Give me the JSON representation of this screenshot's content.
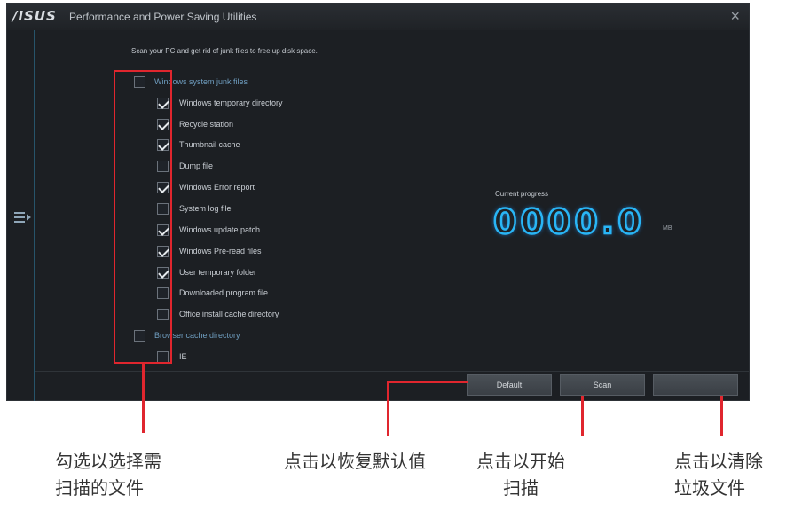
{
  "window": {
    "logo": "/ISUS",
    "title": "Performance and Power Saving Utilities",
    "close": "×"
  },
  "instruction": "Scan your PC and get rid of junk files to free up disk space.",
  "categories": [
    {
      "label": "Windows system junk files",
      "checked": false,
      "items": [
        {
          "label": "Windows temporary directory",
          "checked": true
        },
        {
          "label": "Recycle station",
          "checked": true
        },
        {
          "label": "Thumbnail cache",
          "checked": true
        },
        {
          "label": "Dump file",
          "checked": false
        },
        {
          "label": "Windows Error report",
          "checked": true
        },
        {
          "label": "System log file",
          "checked": false
        },
        {
          "label": "Windows update patch",
          "checked": true
        },
        {
          "label": "Windows Pre-read files",
          "checked": true
        },
        {
          "label": "User temporary folder",
          "checked": true
        },
        {
          "label": "Downloaded program file",
          "checked": false
        },
        {
          "label": "Office install cache directory",
          "checked": false
        }
      ]
    },
    {
      "label": "Browser cache directory",
      "checked": false,
      "items": [
        {
          "label": "IE",
          "checked": false
        }
      ]
    }
  ],
  "progress": {
    "label": "Current progress",
    "value": "0000.0",
    "unit": "MB"
  },
  "buttons": {
    "default": "Default",
    "scan": "Scan",
    "clean": ""
  },
  "annotations": {
    "select": [
      "勾选以选择需",
      "扫描的文件"
    ],
    "default": [
      "点击以恢复默认值"
    ],
    "scan": [
      "点击以开始",
      "扫描"
    ],
    "clean": [
      "点击以清除",
      "垃圾文件"
    ]
  },
  "colors": {
    "accent": "#29b6f6",
    "highlight": "#e0262e",
    "window_bg": "#1c1f23"
  }
}
